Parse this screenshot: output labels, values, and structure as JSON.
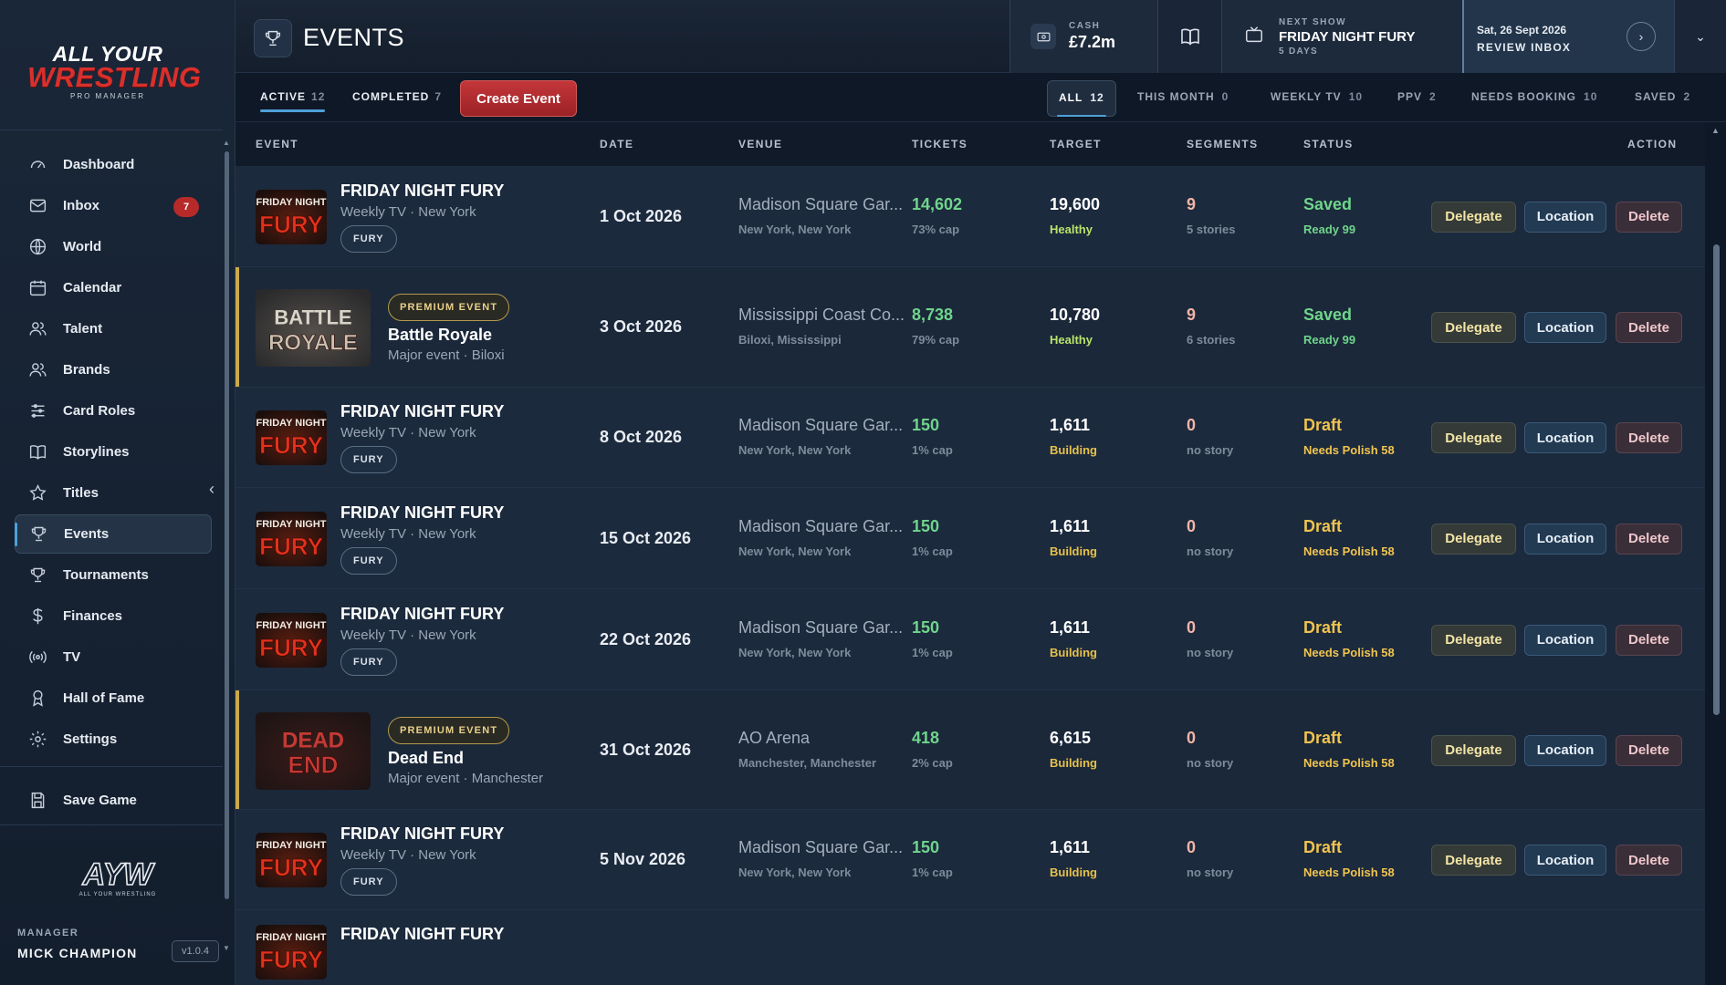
{
  "app": {
    "logo_line1": "ALL YOUR",
    "logo_line2": "WRESTLING",
    "logo_line3": "PRO MANAGER",
    "small_logo": "AYW",
    "small_logo_sub": "ALL YOUR WRESTLING"
  },
  "sidebar": {
    "items": [
      {
        "label": "Dashboard",
        "icon": "gauge-icon"
      },
      {
        "label": "Inbox",
        "icon": "mail-icon",
        "badge": "7"
      },
      {
        "label": "World",
        "icon": "globe-icon"
      },
      {
        "label": "Calendar",
        "icon": "calendar-icon"
      },
      {
        "label": "Talent",
        "icon": "people-icon"
      },
      {
        "label": "Brands",
        "icon": "people-icon"
      },
      {
        "label": "Card Roles",
        "icon": "sliders-icon"
      },
      {
        "label": "Storylines",
        "icon": "book-icon"
      },
      {
        "label": "Titles",
        "icon": "star-icon"
      },
      {
        "label": "Events",
        "icon": "trophy-icon",
        "active": true
      },
      {
        "label": "Tournaments",
        "icon": "trophy-icon"
      },
      {
        "label": "Finances",
        "icon": "dollar-icon"
      },
      {
        "label": "TV",
        "icon": "broadcast-icon"
      },
      {
        "label": "Hall of Fame",
        "icon": "award-icon"
      },
      {
        "label": "Settings",
        "icon": "gear-icon"
      }
    ],
    "save_label": "Save Game",
    "manager_label": "MANAGER",
    "manager_name": "MICK CHAMPION",
    "version": "v1.0.4"
  },
  "header": {
    "title": "EVENTS",
    "cash_label": "CASH",
    "cash_value": "£7.2m",
    "next_show_label": "NEXT SHOW",
    "next_show_title": "FRIDAY NIGHT FURY",
    "next_show_days": "5 DAYS",
    "date": "Sat, 26 Sept 2026",
    "review": "REVIEW INBOX"
  },
  "toolbar": {
    "tabs": [
      {
        "label": "ACTIVE",
        "count": "12",
        "active": true
      },
      {
        "label": "COMPLETED",
        "count": "7"
      }
    ],
    "create_label": "Create Event",
    "filters": [
      {
        "label": "ALL",
        "count": "12",
        "active": true
      },
      {
        "label": "THIS MONTH",
        "count": "0"
      },
      {
        "label": "WEEKLY TV",
        "count": "10"
      },
      {
        "label": "PPV",
        "count": "2"
      },
      {
        "label": "NEEDS BOOKING",
        "count": "10"
      },
      {
        "label": "SAVED",
        "count": "2"
      }
    ]
  },
  "table": {
    "columns": [
      "EVENT",
      "DATE",
      "VENUE",
      "TICKETS",
      "TARGET",
      "SEGMENTS",
      "STATUS",
      "ACTION"
    ],
    "actions": {
      "delegate": "Delegate",
      "location": "Location",
      "delete": "Delete"
    },
    "rows": [
      {
        "kind": "tv",
        "thumb": "fury",
        "title": "FRIDAY NIGHT FURY",
        "sub": "Weekly TV · New York",
        "tag": "FURY",
        "date": "1 Oct 2026",
        "venue": "Madison Square Gar...",
        "venue_sub": "New York, New York",
        "tickets": "14,602",
        "cap": "73% cap",
        "target": "19,600",
        "target_sub": "Healthy",
        "segments": "9",
        "seg_sub": "5 stories",
        "status": "Saved",
        "status_sub": "Ready 99"
      },
      {
        "kind": "premium",
        "thumb": "battle",
        "title": "Battle Royale",
        "sub": "Major event · Biloxi",
        "tag": "PREMIUM EVENT",
        "date": "3 Oct 2026",
        "venue": "Mississippi Coast Co...",
        "venue_sub": "Biloxi, Mississippi",
        "tickets": "8,738",
        "cap": "79% cap",
        "target": "10,780",
        "target_sub": "Healthy",
        "segments": "9",
        "seg_sub": "6 stories",
        "status": "Saved",
        "status_sub": "Ready 99"
      },
      {
        "kind": "tv",
        "thumb": "fury",
        "title": "FRIDAY NIGHT FURY",
        "sub": "Weekly TV · New York",
        "tag": "FURY",
        "date": "8 Oct 2026",
        "venue": "Madison Square Gar...",
        "venue_sub": "New York, New York",
        "tickets": "150",
        "cap": "1% cap",
        "target": "1,611",
        "target_sub": "Building",
        "segments": "0",
        "seg_sub": "no story",
        "status": "Draft",
        "status_sub": "Needs Polish 58"
      },
      {
        "kind": "tv",
        "thumb": "fury",
        "title": "FRIDAY NIGHT FURY",
        "sub": "Weekly TV · New York",
        "tag": "FURY",
        "date": "15 Oct 2026",
        "venue": "Madison Square Gar...",
        "venue_sub": "New York, New York",
        "tickets": "150",
        "cap": "1% cap",
        "target": "1,611",
        "target_sub": "Building",
        "segments": "0",
        "seg_sub": "no story",
        "status": "Draft",
        "status_sub": "Needs Polish 58"
      },
      {
        "kind": "tv",
        "thumb": "fury",
        "title": "FRIDAY NIGHT FURY",
        "sub": "Weekly TV · New York",
        "tag": "FURY",
        "date": "22 Oct 2026",
        "venue": "Madison Square Gar...",
        "venue_sub": "New York, New York",
        "tickets": "150",
        "cap": "1% cap",
        "target": "1,611",
        "target_sub": "Building",
        "segments": "0",
        "seg_sub": "no story",
        "status": "Draft",
        "status_sub": "Needs Polish 58"
      },
      {
        "kind": "premium",
        "thumb": "dead",
        "title": "Dead End",
        "sub": "Major event · Manchester",
        "tag": "PREMIUM EVENT",
        "date": "31 Oct 2026",
        "venue": "AO Arena",
        "venue_sub": "Manchester, Manchester",
        "tickets": "418",
        "cap": "2% cap",
        "target": "6,615",
        "target_sub": "Building",
        "segments": "0",
        "seg_sub": "no story",
        "status": "Draft",
        "status_sub": "Needs Polish 58"
      },
      {
        "kind": "tv",
        "thumb": "fury",
        "title": "FRIDAY NIGHT FURY",
        "sub": "Weekly TV · New York",
        "tag": "FURY",
        "date": "5 Nov 2026",
        "venue": "Madison Square Gar...",
        "venue_sub": "New York, New York",
        "tickets": "150",
        "cap": "1% cap",
        "target": "1,611",
        "target_sub": "Building",
        "segments": "0",
        "seg_sub": "no story",
        "status": "Draft",
        "status_sub": "Needs Polish 58"
      },
      {
        "kind": "tv",
        "thumb": "fury",
        "title": "FRIDAY NIGHT FURY",
        "sub": "",
        "tag": "",
        "date": "",
        "venue": "",
        "venue_sub": "",
        "tickets": "",
        "cap": "",
        "target": "",
        "target_sub": "",
        "segments": "",
        "seg_sub": "",
        "status": "",
        "status_sub": ""
      }
    ]
  },
  "thumbs": {
    "fury": {
      "line1": "FRIDAY NIGHT",
      "line2": "FURY"
    },
    "battle": {
      "line1": "BATTLE",
      "line2": "ROYALE"
    },
    "dead": {
      "line1": "DEAD",
      "line2": "END"
    }
  },
  "colors": {
    "accent": "#4fa0d8",
    "brand_red": "#d8302c",
    "premium_gold": "#c9a94a",
    "saved_green": "#6fd58b",
    "draft_yellow": "#f0c44f"
  }
}
